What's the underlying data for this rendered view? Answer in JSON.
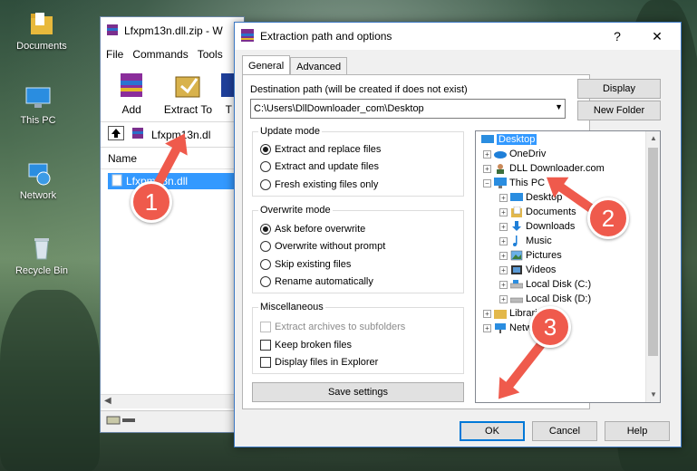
{
  "desktop": {
    "icons": [
      {
        "label": "Documents"
      },
      {
        "label": "This PC"
      },
      {
        "label": "Network"
      },
      {
        "label": "Recycle Bin"
      }
    ]
  },
  "winrar": {
    "title": "Lfxpm13n.dll.zip - W",
    "menu": [
      "File",
      "Commands",
      "Tools"
    ],
    "toolbar": {
      "add": "Add",
      "extract_to": "Extract To",
      "t_label": "T"
    },
    "path": "Lfxpm13n.dl",
    "column_name": "Name",
    "file": "Lfxpm13n.dll"
  },
  "dialog": {
    "title": "Extraction path and options",
    "help_glyph": "?",
    "close_glyph": "✕",
    "tabs": [
      "General",
      "Advanced"
    ],
    "dest_label": "Destination path (will be created if does not exist)",
    "dest_value": "C:\\Users\\DllDownloader_com\\Desktop",
    "display_btn": "Display",
    "new_folder_btn": "New Folder",
    "update_mode": {
      "title": "Update mode",
      "options": [
        "Extract and replace files",
        "Extract and update files",
        "Fresh existing files only"
      ]
    },
    "overwrite_mode": {
      "title": "Overwrite mode",
      "options": [
        "Ask before overwrite",
        "Overwrite without prompt",
        "Skip existing files",
        "Rename automatically"
      ]
    },
    "misc": {
      "title": "Miscellaneous",
      "options": [
        "Extract archives to subfolders",
        "Keep broken files",
        "Display files in Explorer"
      ]
    },
    "save_settings": "Save settings",
    "tree": {
      "desktop": "Desktop",
      "onedrive": "OneDriv",
      "dll_downloader": "DLL Downloader.com",
      "this_pc": "This PC",
      "pc_desktop": "Desktop",
      "documents": "Documents",
      "downloads": "Downloads",
      "music": "Music",
      "pictures": "Pictures",
      "videos": "Videos",
      "local_c": "Local Disk (C:)",
      "local_d": "Local Disk (D:)",
      "libraries": "Librari",
      "network": "Netw"
    },
    "ok": "OK",
    "cancel": "Cancel",
    "help": "Help"
  },
  "annotations": {
    "step1": "1",
    "step2": "2",
    "step3": "3"
  },
  "colors": {
    "accent": "#3399ff",
    "annotation": "#ef5a4c",
    "dialog_border": "#3c78c3"
  }
}
